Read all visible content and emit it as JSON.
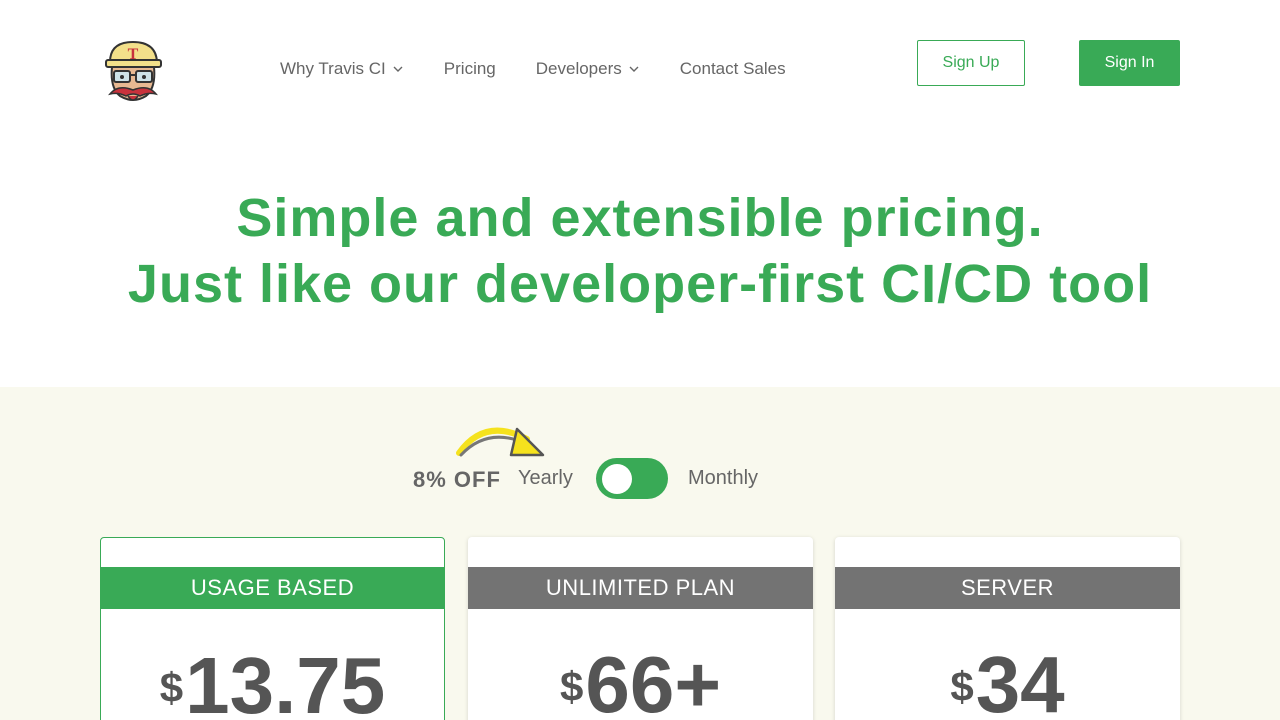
{
  "nav": {
    "items": [
      {
        "label": "Why Travis CI",
        "has_dropdown": true
      },
      {
        "label": "Pricing",
        "has_dropdown": false
      },
      {
        "label": "Developers",
        "has_dropdown": true
      },
      {
        "label": "Contact Sales",
        "has_dropdown": false
      }
    ],
    "sign_up": "Sign Up",
    "sign_in": "Sign In"
  },
  "hero": {
    "line1": "Simple and extensible pricing.",
    "line2": "Just like our developer-first CI/CD tool"
  },
  "billing": {
    "discount": "8% OFF",
    "yearly_label": "Yearly",
    "monthly_label": "Monthly",
    "selected": "Yearly"
  },
  "plans": [
    {
      "name": "USAGE BASED",
      "currency": "$",
      "price": "13.75",
      "highlight": true
    },
    {
      "name": "UNLIMITED PLAN",
      "currency": "$",
      "price": "66+",
      "highlight": false
    },
    {
      "name": "SERVER",
      "currency": "$",
      "price": "34",
      "highlight": false
    }
  ],
  "colors": {
    "brand_green": "#39aa56",
    "band_gray": "#737373",
    "section_bg": "#f9f9ee",
    "arrow_yellow": "#f5e21d"
  },
  "icons": {
    "logo": "travis-mascot-logo",
    "dropdown": "chevron-down-icon",
    "arrow": "curved-arrow-icon"
  }
}
